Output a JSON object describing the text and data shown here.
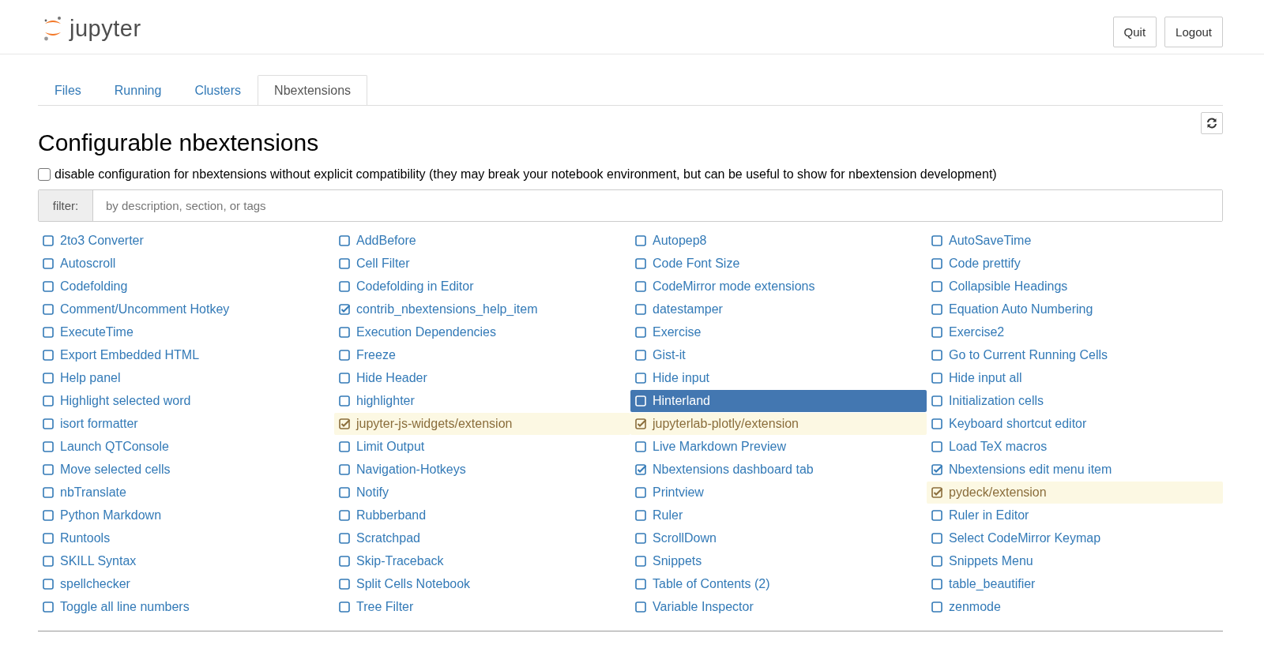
{
  "header": {
    "logo_text": "jupyter",
    "buttons": [
      "Quit",
      "Logout"
    ]
  },
  "tabs": [
    {
      "label": "Files",
      "selected": false
    },
    {
      "label": "Running",
      "selected": false
    },
    {
      "label": "Clusters",
      "selected": false
    },
    {
      "label": "Nbextensions",
      "selected": true
    }
  ],
  "title": "Configurable nbextensions",
  "compat_option": {
    "label": "disable configuration for nbextensions without explicit compatibility (they may break your notebook environment, but can be useful to show for nbextension development)",
    "checked": false
  },
  "filter": {
    "label": "filter:",
    "placeholder": "by description, section, or tags"
  },
  "extensions": [
    {
      "label": "2to3 Converter",
      "checked": false,
      "selected": false,
      "incompatible": false
    },
    {
      "label": "AddBefore",
      "checked": false,
      "selected": false,
      "incompatible": false
    },
    {
      "label": "Autopep8",
      "checked": false,
      "selected": false,
      "incompatible": false
    },
    {
      "label": "AutoSaveTime",
      "checked": false,
      "selected": false,
      "incompatible": false
    },
    {
      "label": "Autoscroll",
      "checked": false,
      "selected": false,
      "incompatible": false
    },
    {
      "label": "Cell Filter",
      "checked": false,
      "selected": false,
      "incompatible": false
    },
    {
      "label": "Code Font Size",
      "checked": false,
      "selected": false,
      "incompatible": false
    },
    {
      "label": "Code prettify",
      "checked": false,
      "selected": false,
      "incompatible": false
    },
    {
      "label": "Codefolding",
      "checked": false,
      "selected": false,
      "incompatible": false
    },
    {
      "label": "Codefolding in Editor",
      "checked": false,
      "selected": false,
      "incompatible": false
    },
    {
      "label": "CodeMirror mode extensions",
      "checked": false,
      "selected": false,
      "incompatible": false
    },
    {
      "label": "Collapsible Headings",
      "checked": false,
      "selected": false,
      "incompatible": false
    },
    {
      "label": "Comment/Uncomment Hotkey",
      "checked": false,
      "selected": false,
      "incompatible": false
    },
    {
      "label": "contrib_nbextensions_help_item",
      "checked": true,
      "selected": false,
      "incompatible": false
    },
    {
      "label": "datestamper",
      "checked": false,
      "selected": false,
      "incompatible": false
    },
    {
      "label": "Equation Auto Numbering",
      "checked": false,
      "selected": false,
      "incompatible": false
    },
    {
      "label": "ExecuteTime",
      "checked": false,
      "selected": false,
      "incompatible": false
    },
    {
      "label": "Execution Dependencies",
      "checked": false,
      "selected": false,
      "incompatible": false
    },
    {
      "label": "Exercise",
      "checked": false,
      "selected": false,
      "incompatible": false
    },
    {
      "label": "Exercise2",
      "checked": false,
      "selected": false,
      "incompatible": false
    },
    {
      "label": "Export Embedded HTML",
      "checked": false,
      "selected": false,
      "incompatible": false
    },
    {
      "label": "Freeze",
      "checked": false,
      "selected": false,
      "incompatible": false
    },
    {
      "label": "Gist-it",
      "checked": false,
      "selected": false,
      "incompatible": false
    },
    {
      "label": "Go to Current Running Cells",
      "checked": false,
      "selected": false,
      "incompatible": false
    },
    {
      "label": "Help panel",
      "checked": false,
      "selected": false,
      "incompatible": false
    },
    {
      "label": "Hide Header",
      "checked": false,
      "selected": false,
      "incompatible": false
    },
    {
      "label": "Hide input",
      "checked": false,
      "selected": false,
      "incompatible": false
    },
    {
      "label": "Hide input all",
      "checked": false,
      "selected": false,
      "incompatible": false
    },
    {
      "label": "Highlight selected word",
      "checked": false,
      "selected": false,
      "incompatible": false
    },
    {
      "label": "highlighter",
      "checked": false,
      "selected": false,
      "incompatible": false
    },
    {
      "label": "Hinterland",
      "checked": false,
      "selected": true,
      "incompatible": false
    },
    {
      "label": "Initialization cells",
      "checked": false,
      "selected": false,
      "incompatible": false
    },
    {
      "label": "isort formatter",
      "checked": false,
      "selected": false,
      "incompatible": false
    },
    {
      "label": "jupyter-js-widgets/extension",
      "checked": true,
      "selected": false,
      "incompatible": true
    },
    {
      "label": "jupyterlab-plotly/extension",
      "checked": true,
      "selected": false,
      "incompatible": true
    },
    {
      "label": "Keyboard shortcut editor",
      "checked": false,
      "selected": false,
      "incompatible": false
    },
    {
      "label": "Launch QTConsole",
      "checked": false,
      "selected": false,
      "incompatible": false
    },
    {
      "label": "Limit Output",
      "checked": false,
      "selected": false,
      "incompatible": false
    },
    {
      "label": "Live Markdown Preview",
      "checked": false,
      "selected": false,
      "incompatible": false
    },
    {
      "label": "Load TeX macros",
      "checked": false,
      "selected": false,
      "incompatible": false
    },
    {
      "label": "Move selected cells",
      "checked": false,
      "selected": false,
      "incompatible": false
    },
    {
      "label": "Navigation-Hotkeys",
      "checked": false,
      "selected": false,
      "incompatible": false
    },
    {
      "label": "Nbextensions dashboard tab",
      "checked": true,
      "selected": false,
      "incompatible": false
    },
    {
      "label": "Nbextensions edit menu item",
      "checked": true,
      "selected": false,
      "incompatible": false
    },
    {
      "label": "nbTranslate",
      "checked": false,
      "selected": false,
      "incompatible": false
    },
    {
      "label": "Notify",
      "checked": false,
      "selected": false,
      "incompatible": false
    },
    {
      "label": "Printview",
      "checked": false,
      "selected": false,
      "incompatible": false
    },
    {
      "label": "pydeck/extension",
      "checked": true,
      "selected": false,
      "incompatible": true
    },
    {
      "label": "Python Markdown",
      "checked": false,
      "selected": false,
      "incompatible": false
    },
    {
      "label": "Rubberband",
      "checked": false,
      "selected": false,
      "incompatible": false
    },
    {
      "label": "Ruler",
      "checked": false,
      "selected": false,
      "incompatible": false
    },
    {
      "label": "Ruler in Editor",
      "checked": false,
      "selected": false,
      "incompatible": false
    },
    {
      "label": "Runtools",
      "checked": false,
      "selected": false,
      "incompatible": false
    },
    {
      "label": "Scratchpad",
      "checked": false,
      "selected": false,
      "incompatible": false
    },
    {
      "label": "ScrollDown",
      "checked": false,
      "selected": false,
      "incompatible": false
    },
    {
      "label": "Select CodeMirror Keymap",
      "checked": false,
      "selected": false,
      "incompatible": false
    },
    {
      "label": "SKILL Syntax",
      "checked": false,
      "selected": false,
      "incompatible": false
    },
    {
      "label": "Skip-Traceback",
      "checked": false,
      "selected": false,
      "incompatible": false
    },
    {
      "label": "Snippets",
      "checked": false,
      "selected": false,
      "incompatible": false
    },
    {
      "label": "Snippets Menu",
      "checked": false,
      "selected": false,
      "incompatible": false
    },
    {
      "label": "spellchecker",
      "checked": false,
      "selected": false,
      "incompatible": false
    },
    {
      "label": "Split Cells Notebook",
      "checked": false,
      "selected": false,
      "incompatible": false
    },
    {
      "label": "Table of Contents (2)",
      "checked": false,
      "selected": false,
      "incompatible": false
    },
    {
      "label": "table_beautifier",
      "checked": false,
      "selected": false,
      "incompatible": false
    },
    {
      "label": "Toggle all line numbers",
      "checked": false,
      "selected": false,
      "incompatible": false
    },
    {
      "label": "Tree Filter",
      "checked": false,
      "selected": false,
      "incompatible": false
    },
    {
      "label": "Variable Inspector",
      "checked": false,
      "selected": false,
      "incompatible": false
    },
    {
      "label": "zenmode",
      "checked": false,
      "selected": false,
      "incompatible": false
    }
  ]
}
